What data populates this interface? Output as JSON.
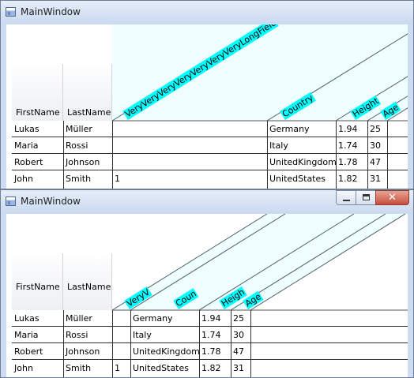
{
  "window_top": {
    "title": "MainWindow",
    "columns": {
      "firstname": "FirstName",
      "lastname": "LastName",
      "long": "VeryVeryVeryVeryVeryVeryVeryLongField",
      "country": "Country",
      "height": "Height",
      "age": "Age"
    }
  },
  "window_bottom": {
    "title": "MainWindow",
    "columns": {
      "firstname": "FirstName",
      "lastname": "LastName",
      "long": "VeryV",
      "country": "Coun",
      "height": "Heigh",
      "age": "Age"
    }
  },
  "rows": [
    {
      "first": "Lukas",
      "last": "Müller",
      "long": "",
      "country": "Germany",
      "height": "1.94",
      "age": "25"
    },
    {
      "first": "Maria",
      "last": "Rossi",
      "long": "",
      "country": "Italy",
      "height": "1.74",
      "age": "30"
    },
    {
      "first": "Robert",
      "last": "Johnson",
      "long": "",
      "country": "UnitedKingdom",
      "height": "1.78",
      "age": "47"
    },
    {
      "first": "John",
      "last": "Smith",
      "long": "1",
      "country": "UnitedStates",
      "height": "1.82",
      "age": "31"
    }
  ]
}
